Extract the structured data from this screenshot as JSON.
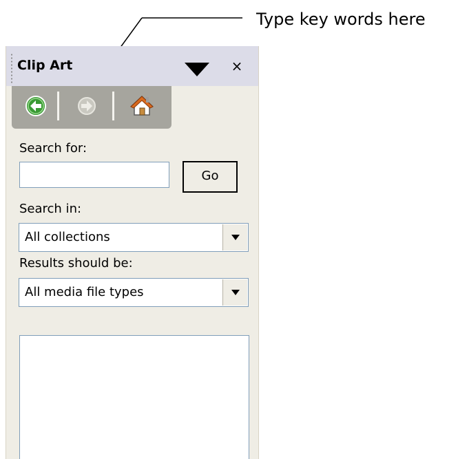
{
  "callout": {
    "text": "Type key words here"
  },
  "pane": {
    "title": "Clip Art",
    "menu_icon": "triangle-down-icon",
    "close_label": "×"
  },
  "nav": {
    "back_icon": "back-arrow-icon",
    "forward_icon": "forward-arrow-icon",
    "home_icon": "home-icon"
  },
  "search": {
    "label": "Search for:",
    "value": "",
    "go_label": "Go"
  },
  "search_in": {
    "label": "Search in:",
    "selected": "All collections"
  },
  "results_type": {
    "label": "Results should be:",
    "selected": "All media file types"
  },
  "colors": {
    "pane_background": "#efede5",
    "header_background": "#dcdce8",
    "nav_background": "#a6a59e",
    "back_icon_green": "#3a9a34",
    "home_roof_orange": "#d96a1e"
  }
}
